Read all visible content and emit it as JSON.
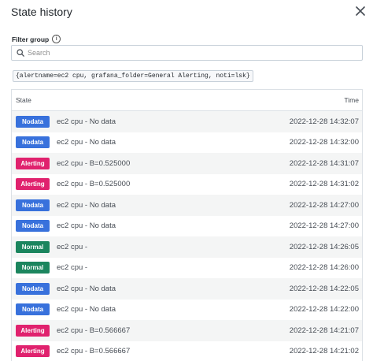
{
  "modal": {
    "title": "State history",
    "close_icon": "close-icon"
  },
  "filter": {
    "label": "Filter group",
    "info_icon": "info-icon",
    "search_icon": "search-icon",
    "placeholder": "Search",
    "value": ""
  },
  "labels_text": "{alertname=ec2 cpu, grafana_folder=General Alerting, noti=lsk}",
  "table": {
    "header_state": "State",
    "header_time": "Time",
    "rows": [
      {
        "state": "Nodata",
        "text": "ec2 cpu - No data",
        "time": "2022-12-28 14:32:07"
      },
      {
        "state": "Nodata",
        "text": "ec2 cpu - No data",
        "time": "2022-12-28 14:32:00"
      },
      {
        "state": "Alerting",
        "text": "ec2 cpu - B=0.525000",
        "time": "2022-12-28 14:31:07"
      },
      {
        "state": "Alerting",
        "text": "ec2 cpu - B=0.525000",
        "time": "2022-12-28 14:31:02"
      },
      {
        "state": "Nodata",
        "text": "ec2 cpu - No data",
        "time": "2022-12-28 14:27:00"
      },
      {
        "state": "Nodata",
        "text": "ec2 cpu - No data",
        "time": "2022-12-28 14:27:00"
      },
      {
        "state": "Normal",
        "text": "ec2 cpu -",
        "time": "2022-12-28 14:26:05"
      },
      {
        "state": "Normal",
        "text": "ec2 cpu -",
        "time": "2022-12-28 14:26:00"
      },
      {
        "state": "Nodata",
        "text": "ec2 cpu - No data",
        "time": "2022-12-28 14:22:05"
      },
      {
        "state": "Nodata",
        "text": "ec2 cpu - No data",
        "time": "2022-12-28 14:22:00"
      },
      {
        "state": "Alerting",
        "text": "ec2 cpu - B=0.566667",
        "time": "2022-12-28 14:21:07"
      },
      {
        "state": "Alerting",
        "text": "ec2 cpu - B=0.566667",
        "time": "2022-12-28 14:21:02"
      }
    ]
  },
  "colors": {
    "Nodata": "#3871dc",
    "Alerting": "#e0226e",
    "Normal": "#1b855e"
  }
}
